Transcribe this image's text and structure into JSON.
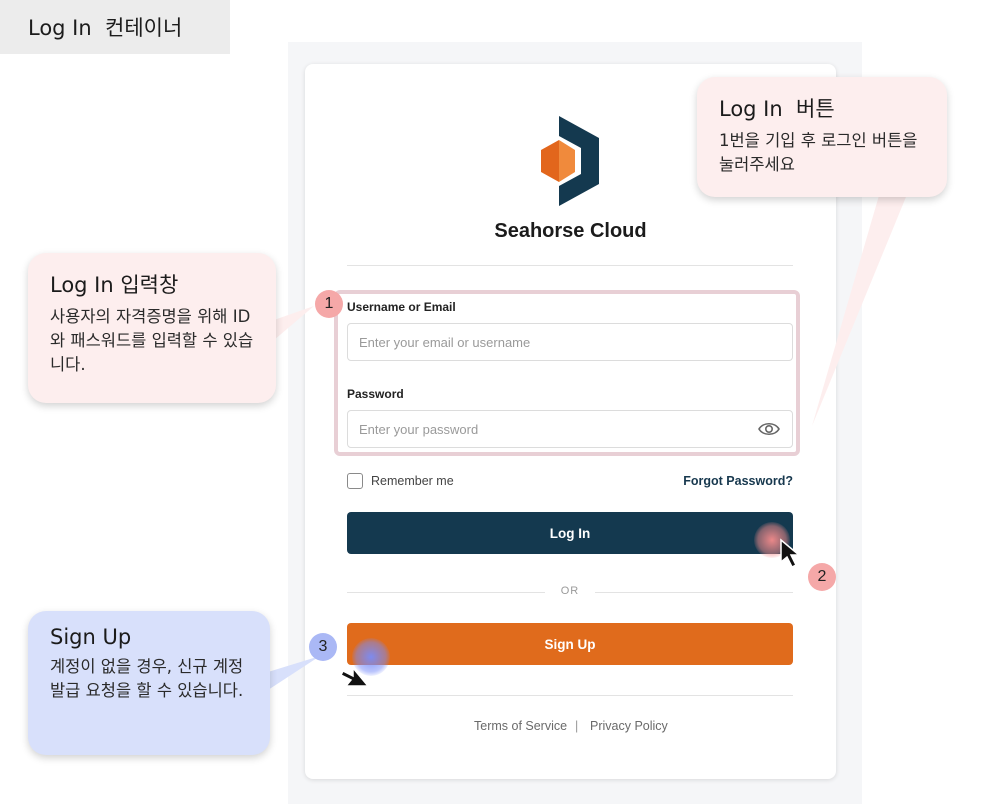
{
  "page": {
    "container_title": "Log In  컨테이너"
  },
  "brand": {
    "name": "Seahorse Cloud"
  },
  "form": {
    "username_label": "Username or Email",
    "username_placeholder": "Enter your email or username",
    "password_label": "Password",
    "password_placeholder": "Enter your password",
    "remember_label": "Remember me",
    "forgot_label": "Forgot Password?",
    "login_label": "Log In",
    "or_label": "OR",
    "signup_label": "Sign Up"
  },
  "footer": {
    "terms": "Terms of Service",
    "separator": "|",
    "privacy": "Privacy Policy"
  },
  "annotations": {
    "login_button": {
      "title": "Log In  버튼",
      "body": "1번을 기입 후 로그인 버튼을 눌러주세요"
    },
    "input_area": {
      "title": "Log In 입력창",
      "body": "사용자의 자격증명을 위해 ID 와 패스워드를 입력할 수 있습니다."
    },
    "sign_up": {
      "title": "Sign Up",
      "body": "계정이 없을 경우, 신규 계정 발급 요청을 할 수 있습니다."
    }
  },
  "badges": {
    "one": "1",
    "two": "2",
    "three": "3"
  },
  "colors": {
    "primary_navy": "#14394f",
    "accent_orange": "#e06b1c",
    "callout_pink": "#fdeeee",
    "callout_blue": "#d8e0fb",
    "highlight_border": "#e8cfd5"
  },
  "icons": {
    "password_toggle": "eye-icon",
    "cursor": "mouse-pointer-icon",
    "logo": "seahorse-logo"
  }
}
